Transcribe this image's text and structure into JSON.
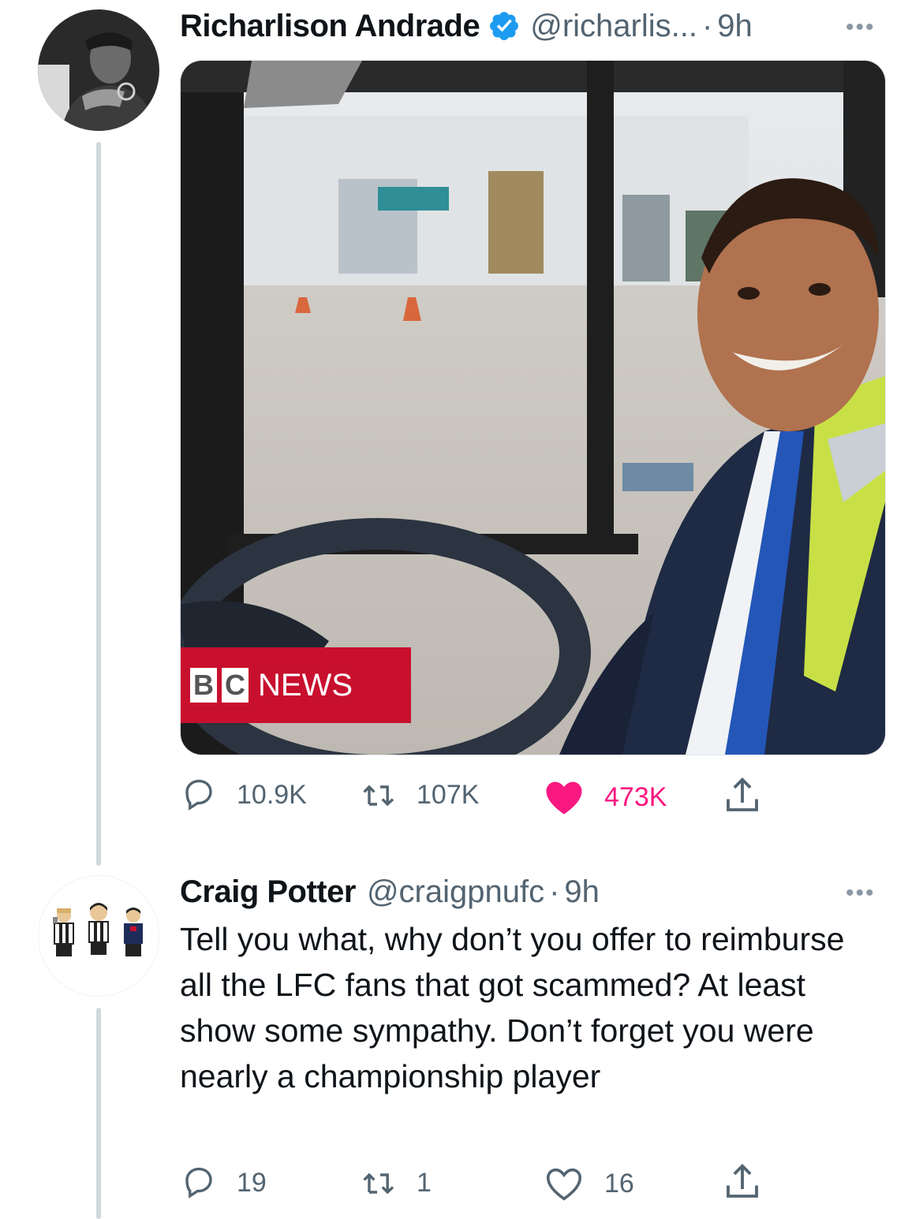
{
  "tweets": [
    {
      "author_name": "Richarlison Andrade",
      "verified": true,
      "handle": "@richarlis...",
      "separator": "·",
      "time": "9h",
      "more": "•••",
      "media": {
        "badge_blocks": [
          "B",
          "C"
        ],
        "badge_text": "NEWS"
      },
      "stats": {
        "replies": "10.9K",
        "retweets": "107K",
        "likes": "473K",
        "liked": true
      }
    },
    {
      "author_name": "Craig Potter",
      "handle": "@craigpnufc",
      "separator": "·",
      "time": "9h",
      "more": "•••",
      "text": "Tell you what, why don’t you offer to reimburse all the LFC fans that got scammed? At least show some sympathy. Don’t forget you were nearly a championship player",
      "stats": {
        "replies": "19",
        "retweets": "1",
        "likes": "16",
        "liked": false
      }
    }
  ],
  "colors": {
    "like_active": "#f91880",
    "verified": "#1d9bf0",
    "muted": "#536471",
    "bbc_red": "#c8102e"
  }
}
